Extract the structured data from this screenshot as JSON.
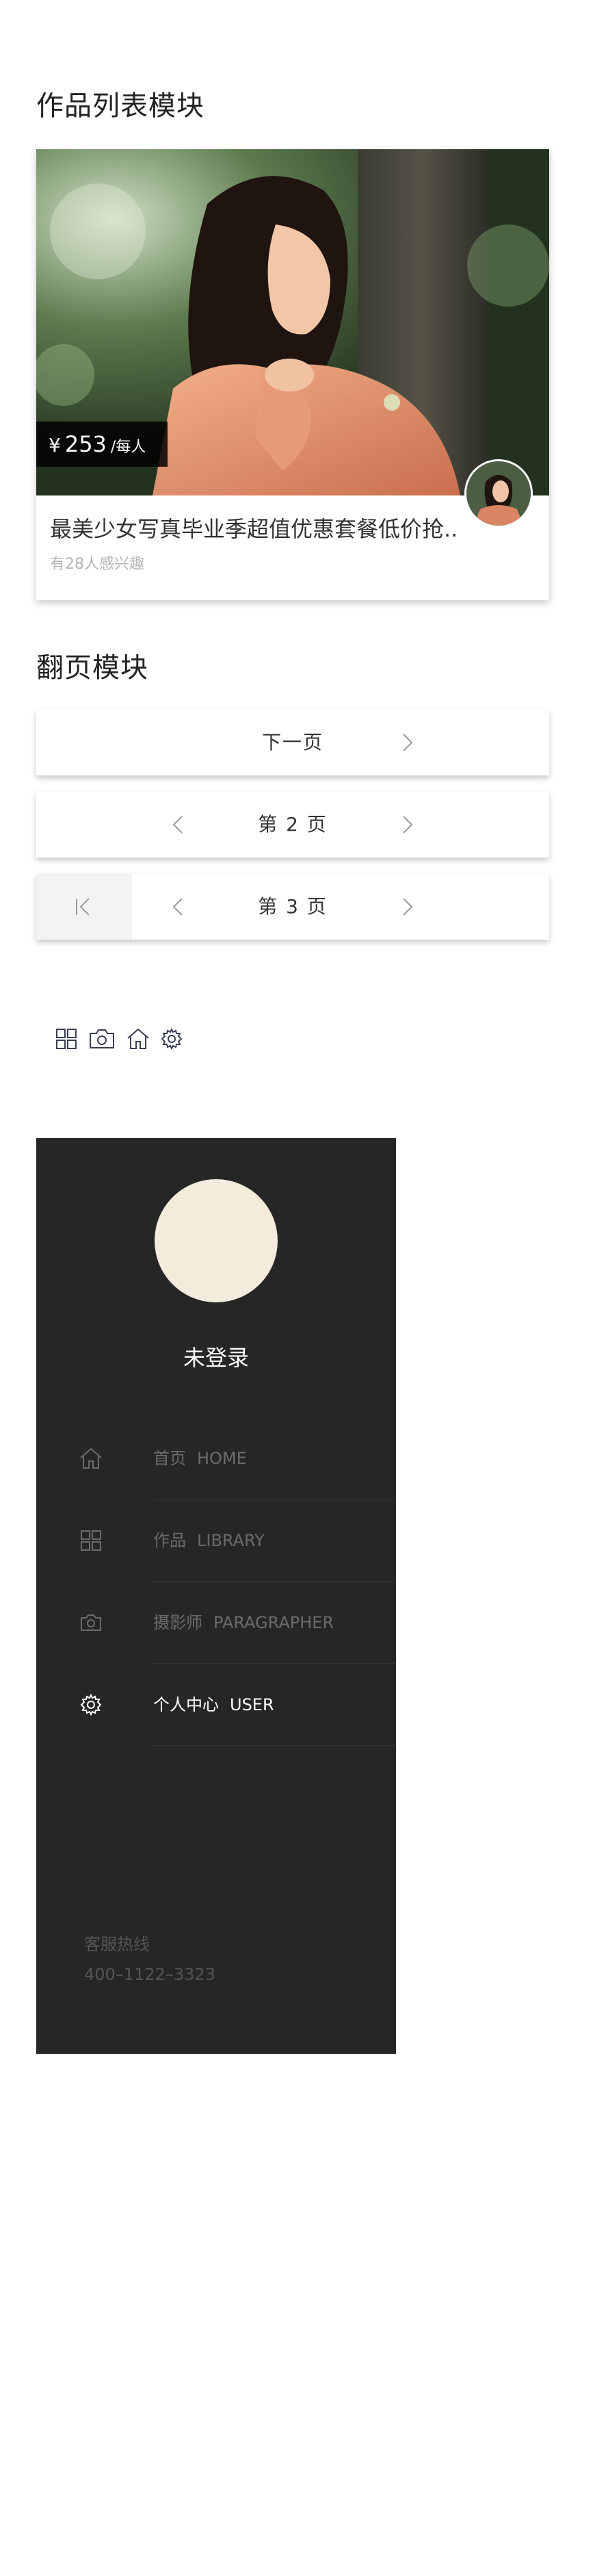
{
  "work_section": {
    "title": "作品列表模块",
    "card": {
      "price_currency": "¥",
      "price_amount": "253",
      "price_unit": "/每人",
      "title": "最美少女写真毕业季超值优惠套餐低价抢..",
      "interest": "有28人感兴趣"
    }
  },
  "pager_section": {
    "title": "翻页模块",
    "pagers": [
      {
        "label": "下一页"
      },
      {
        "label": "第 2 页"
      },
      {
        "label": "第 3 页"
      }
    ]
  },
  "icons": [
    "grid-icon",
    "camera-icon",
    "home-icon",
    "gear-icon"
  ],
  "drawer": {
    "login_label": "未登录",
    "menu": [
      {
        "cn": "首页",
        "en": "HOME",
        "icon": "home-icon"
      },
      {
        "cn": "作品",
        "en": "LIBRARY",
        "icon": "grid-icon"
      },
      {
        "cn": "摄影师",
        "en": "PARAGRAPHER",
        "icon": "camera-icon"
      },
      {
        "cn": "个人中心",
        "en": "USER",
        "icon": "gear-icon"
      }
    ],
    "active_index": 3,
    "hotline_label": "客服热线",
    "hotline_number": "400–1122–3323"
  },
  "colors": {
    "drawer_bg": "#262626",
    "avatar_placeholder": "#f3ecdc",
    "price_tag_bg": "#000000"
  }
}
